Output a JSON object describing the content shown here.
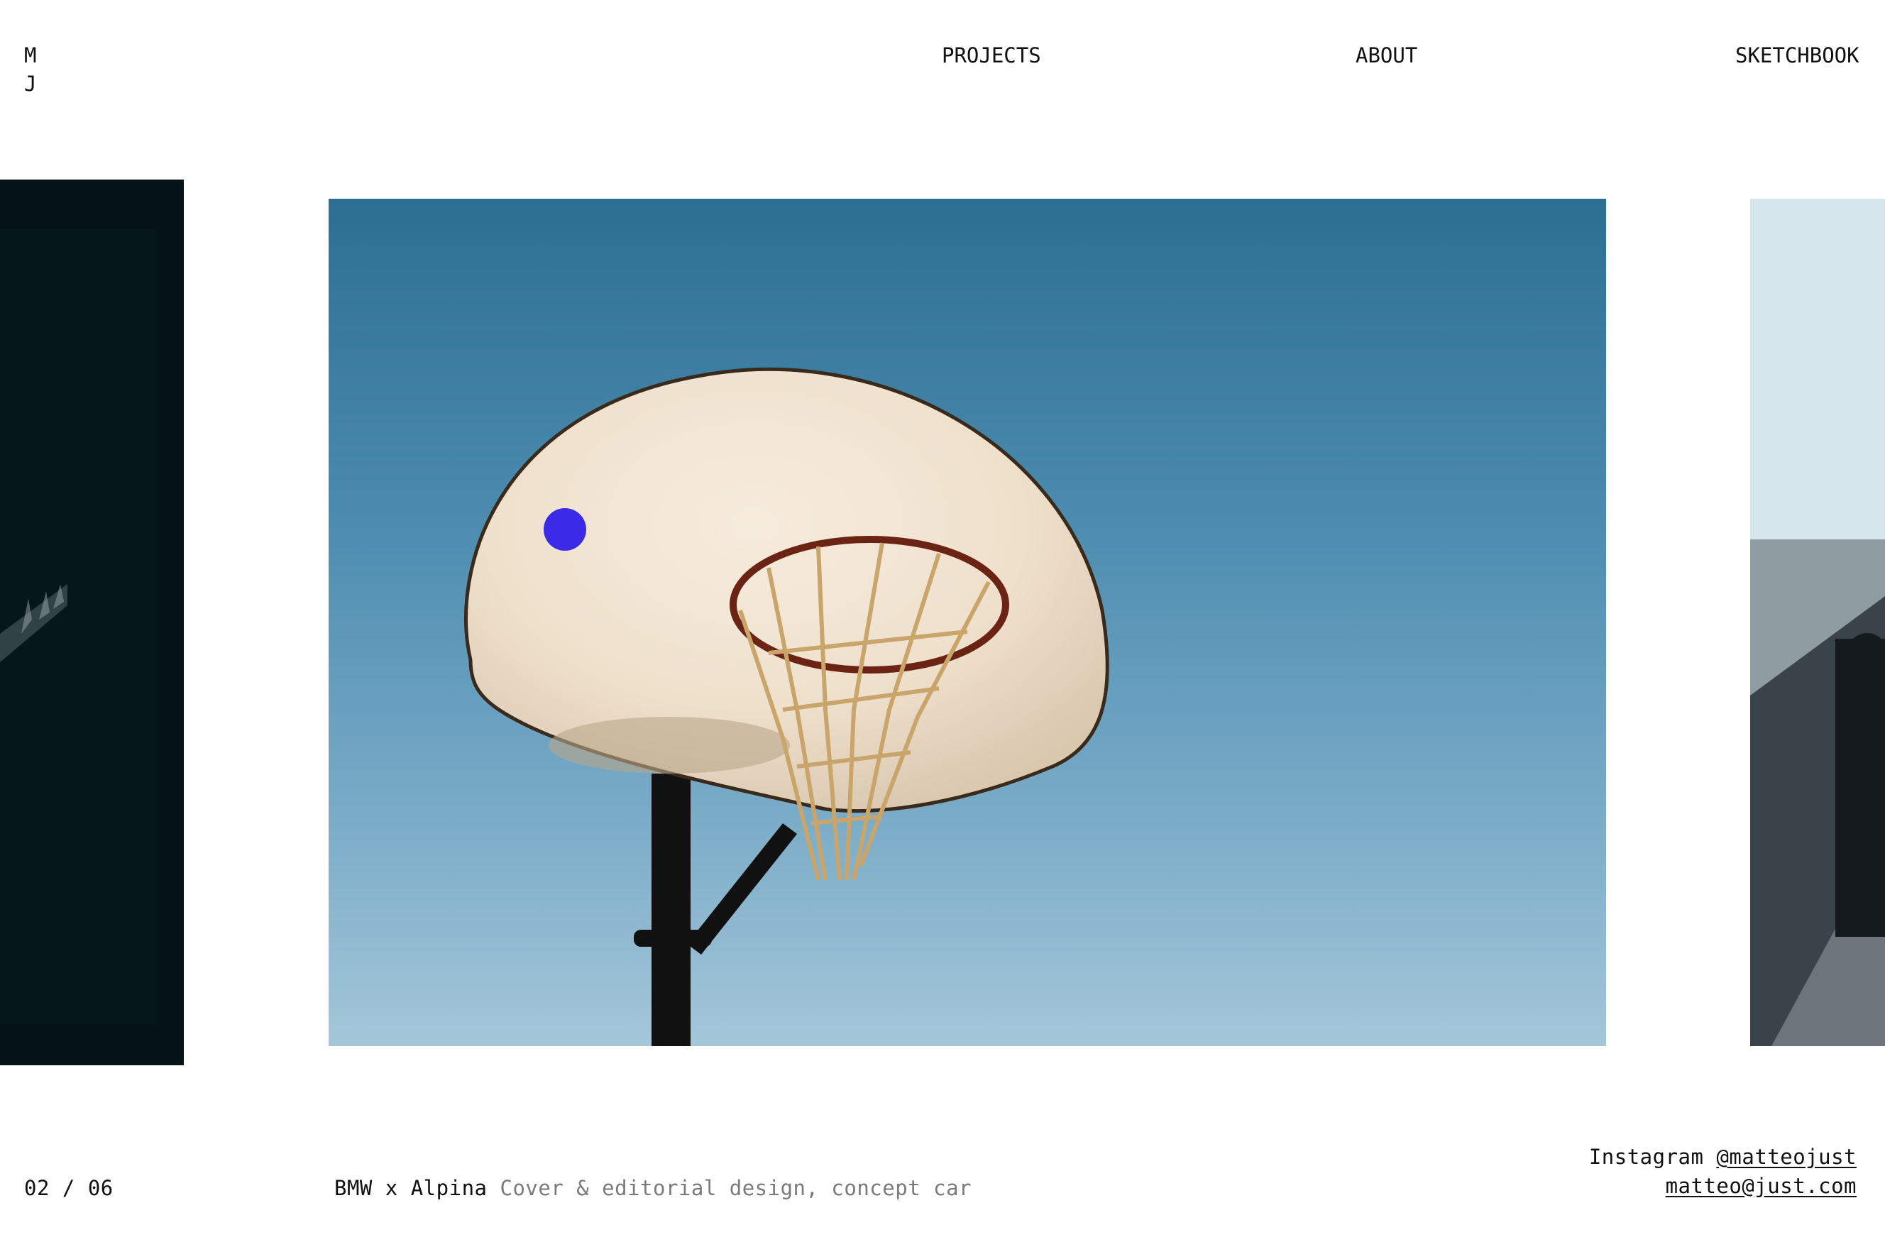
{
  "header": {
    "logo_line1": "M",
    "logo_line2": "J",
    "nav": {
      "projects": "PROJECTS",
      "about": "ABOUT",
      "sketchbook": "SKETCHBOOK"
    }
  },
  "carousel": {
    "counter_current": "02",
    "counter_separator": "/",
    "counter_total": "06",
    "caption_title": "BMW x Alpina",
    "caption_description": "Cover & editorial design, concept car",
    "accent_color": "#3b2be6"
  },
  "footer": {
    "instagram_label": "Instagram",
    "instagram_handle": "@matteojust",
    "email": "matteo@just.com"
  }
}
